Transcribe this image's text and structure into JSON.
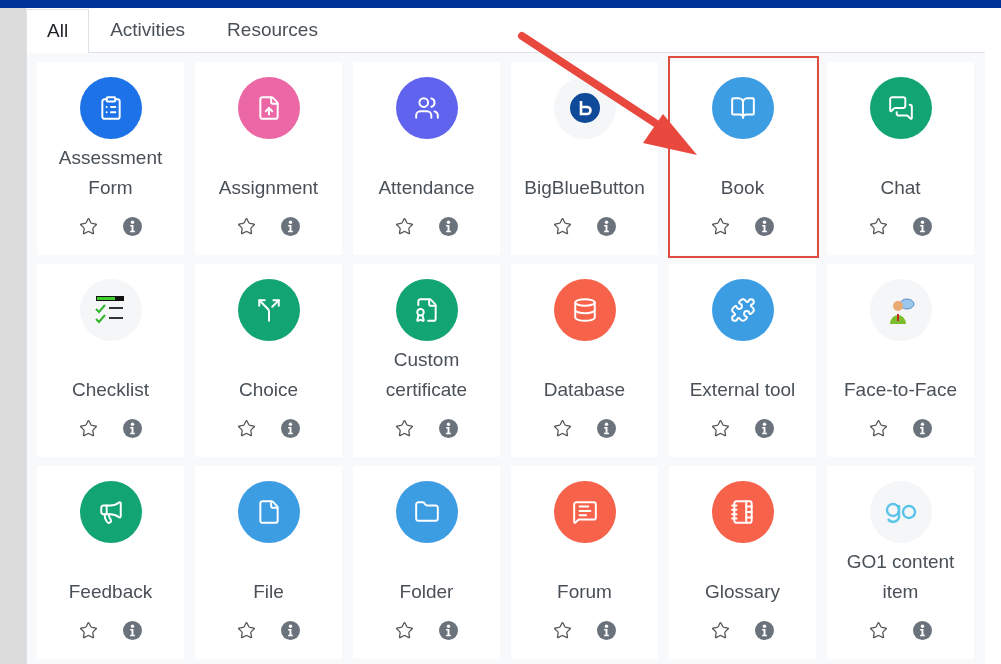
{
  "tabs": [
    {
      "label": "All",
      "selected": true
    },
    {
      "label": "Activities",
      "selected": false
    },
    {
      "label": "Resources",
      "selected": false
    }
  ],
  "modules": [
    {
      "name": "Assessment Form",
      "color": "#1d72e8",
      "starred": false,
      "highlighted": false
    },
    {
      "name": "Assignment",
      "color": "#ec67a5",
      "starred": false,
      "highlighted": false
    },
    {
      "name": "Attendance",
      "color": "#5f63ee",
      "starred": false,
      "highlighted": false
    },
    {
      "name": "BigBlueButton",
      "color": "#f5f6f8",
      "starred": false,
      "highlighted": false
    },
    {
      "name": "Book",
      "color": "#3d9de3",
      "starred": false,
      "highlighted": true
    },
    {
      "name": "Chat",
      "color": "#13a474",
      "starred": false,
      "highlighted": false
    },
    {
      "name": "Checklist",
      "color": "#f5f6f8",
      "starred": false,
      "highlighted": false
    },
    {
      "name": "Choice",
      "color": "#13a474",
      "starred": false,
      "highlighted": false
    },
    {
      "name": "Custom certificate",
      "color": "#13a474",
      "starred": false,
      "highlighted": false
    },
    {
      "name": "Database",
      "color": "#f7624b",
      "starred": false,
      "highlighted": false
    },
    {
      "name": "External tool",
      "color": "#3d9de3",
      "starred": false,
      "highlighted": false
    },
    {
      "name": "Face-to-Face",
      "color": "#f5f6f8",
      "starred": false,
      "highlighted": false
    },
    {
      "name": "Feedback",
      "color": "#13a474",
      "starred": false,
      "highlighted": false
    },
    {
      "name": "File",
      "color": "#3d9de3",
      "starred": false,
      "highlighted": false
    },
    {
      "name": "Folder",
      "color": "#3d9de3",
      "starred": false,
      "highlighted": false
    },
    {
      "name": "Forum",
      "color": "#f7624b",
      "starred": false,
      "highlighted": false
    },
    {
      "name": "Glossary",
      "color": "#f7624b",
      "starred": false,
      "highlighted": false
    },
    {
      "name": "GO1 content item",
      "color": "#f5f6f8",
      "starred": false,
      "highlighted": false
    }
  ]
}
